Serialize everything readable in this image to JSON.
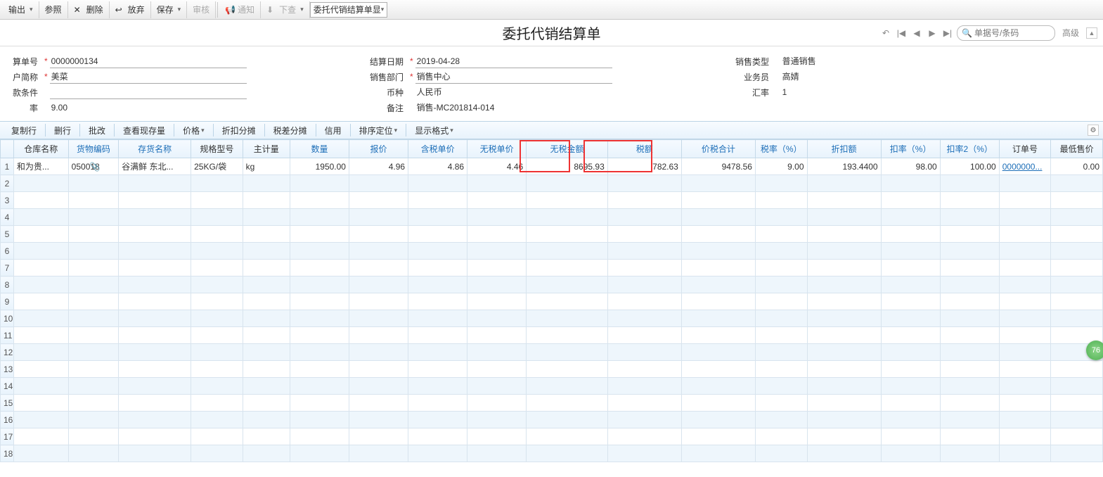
{
  "toolbar": {
    "output": "输出",
    "ref": "参照",
    "delete": "删除",
    "discard": "放弃",
    "save": "保存",
    "audit": "审核",
    "notify": "通知",
    "pushdown": "下查",
    "display_label": "委托代销结算单显"
  },
  "title": "委托代销结算单",
  "search": {
    "placeholder": "单据号/条码"
  },
  "advanced": "高级",
  "form": {
    "doc_no_label": "算单号",
    "doc_no": "0000000134",
    "cust_label": "户简称",
    "cust": "美菜",
    "terms_label": "款条件",
    "terms": "",
    "rate_label": "率",
    "rate": "9.00",
    "date_label": "结算日期",
    "date": "2019-04-28",
    "dept_label": "销售部门",
    "dept": "销售中心",
    "currency_label": "币种",
    "currency": "人民币",
    "remark_label": "备注",
    "remark": "销售-MC201814-014",
    "sale_type_label": "销售类型",
    "sale_type": "普通销售",
    "sales_label": "业务员",
    "sales": "高婧",
    "exrate_label": "汇率",
    "exrate": "1"
  },
  "actions": {
    "copy_row": "复制行",
    "del_row": "删行",
    "batch": "批改",
    "check_stock": "查看现存量",
    "price": "价格",
    "discount_split": "折扣分摊",
    "tax_split": "税差分摊",
    "credit": "信用",
    "sort": "排序定位",
    "display_fmt": "显示格式"
  },
  "headers": {
    "warehouse": "仓库名称",
    "inv_code": "货物编码",
    "inv_name": "存货名称",
    "spec": "规格型号",
    "unit": "主计量",
    "qty": "数量",
    "price": "报价",
    "tax_price": "含税单价",
    "notax_price": "无税单价",
    "notax_amt": "无税金额",
    "tax": "税额",
    "total": "价税合计",
    "tax_rate": "税率（%）",
    "discount": "折扣额",
    "disc_rate": "扣率（%）",
    "disc_rate2": "扣率2（%）",
    "order_no": "订单号",
    "min_price": "最低售价"
  },
  "rows": [
    {
      "warehouse": "和为贵...",
      "inv_code": "050018",
      "inv_name": "谷满鲜 东北...",
      "spec": "25KG/袋",
      "unit": "kg",
      "qty": "1950.00",
      "price": "4.96",
      "tax_price": "4.86",
      "notax_price": "4.46",
      "notax_amt": "8695.93",
      "tax": "782.63",
      "total": "9478.56",
      "tax_rate": "9.00",
      "discount": "193.4400",
      "disc_rate": "98.00",
      "disc_rate2": "100.00",
      "order_no": "0000000...",
      "min_price": "0.00"
    }
  ],
  "badge": "76"
}
